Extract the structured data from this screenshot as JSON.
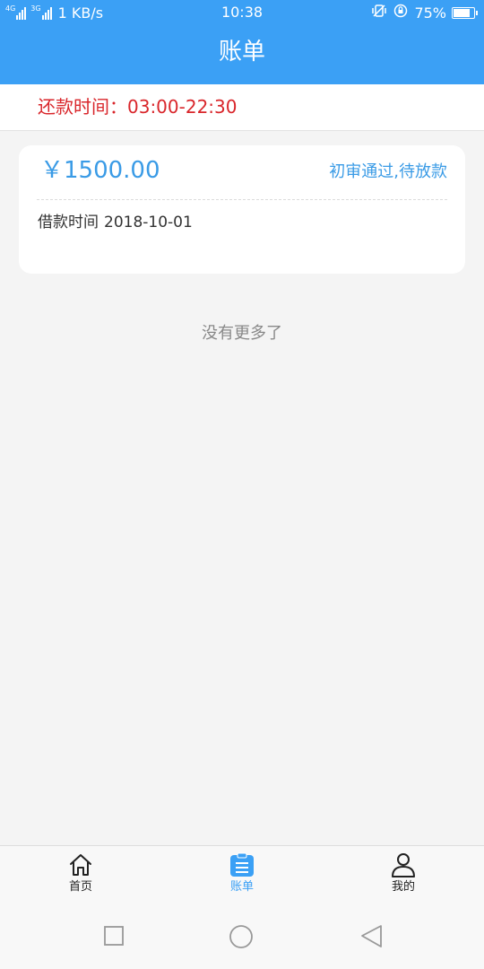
{
  "status_bar": {
    "network_1": "4G",
    "network_2": "3G",
    "speed": "1 KB/s",
    "time": "10:38",
    "battery": "75%",
    "battery_level": 0.75
  },
  "header": {
    "title": "账单"
  },
  "repayment": {
    "text": "还款时间：03:00-22:30"
  },
  "bills": [
    {
      "amount": "￥1500.00",
      "status": "初审通过,待放款",
      "date_label": "借款时间",
      "date_value": "2018-10-01"
    }
  ],
  "list_footer": "没有更多了",
  "tabbar": {
    "items": [
      {
        "label": "首页",
        "icon": "home-icon",
        "active": false
      },
      {
        "label": "账单",
        "icon": "bill-icon",
        "active": true
      },
      {
        "label": "我的",
        "icon": "user-icon",
        "active": false
      }
    ]
  },
  "colors": {
    "brand": "#3ba0f5",
    "amount": "#3a9be6",
    "warning": "#d9262b",
    "background": "#f4f4f4"
  },
  "system_nav": {
    "buttons": [
      "recent-apps-icon",
      "home-circle-icon",
      "back-icon"
    ]
  }
}
